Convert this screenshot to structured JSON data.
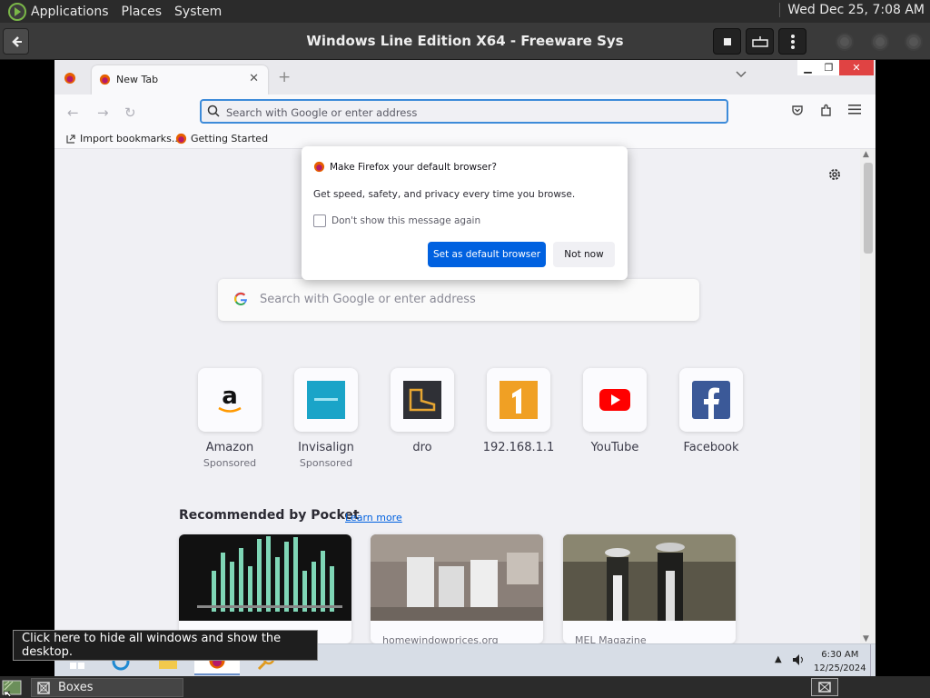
{
  "top_panel": {
    "menus": [
      "Applications",
      "Places",
      "System"
    ],
    "clock": "Wed Dec 25,  7:08 AM"
  },
  "boxes": {
    "title": "Windows Line Edition X64 - Freeware Sys"
  },
  "firefox": {
    "tab_title": "New Tab",
    "new_tab_symbol": "+",
    "url_placeholder": "Search with Google or enter address",
    "bookmarks": [
      "Import bookmarks...",
      "Getting Started"
    ]
  },
  "dialog": {
    "title": "Make Firefox your default browser?",
    "body": "Get speed, safety, and privacy every time you browse.",
    "checkbox_label": "Don't show this message again",
    "primary_button": "Set as default browser",
    "secondary_button": "Not now"
  },
  "newtab": {
    "search_placeholder": "Search with Google or enter address",
    "tiles": [
      {
        "name": "Amazon",
        "sponsor": "Sponsored"
      },
      {
        "name": "Invisalign",
        "sponsor": "Sponsored"
      },
      {
        "name": "dro",
        "sponsor": ""
      },
      {
        "name": "192.168.1.1",
        "sponsor": ""
      },
      {
        "name": "YouTube",
        "sponsor": ""
      },
      {
        "name": "Facebook",
        "sponsor": ""
      }
    ],
    "pocket_heading": "Recommended by Pocket",
    "learn_more": "Learn more",
    "cards": [
      {
        "source": ""
      },
      {
        "source": "homewindowprices.org"
      },
      {
        "source": "MEL Magazine"
      }
    ]
  },
  "windows_taskbar": {
    "time": "6:30 AM",
    "date": "12/25/2024"
  },
  "tooltip": "Click here to hide all windows and show the desktop.",
  "bottom_panel": {
    "task_label": "Boxes"
  },
  "colors": {
    "accent": "#0061e0",
    "url_focus": "#3d8bd9",
    "close_red": "#e04343"
  }
}
